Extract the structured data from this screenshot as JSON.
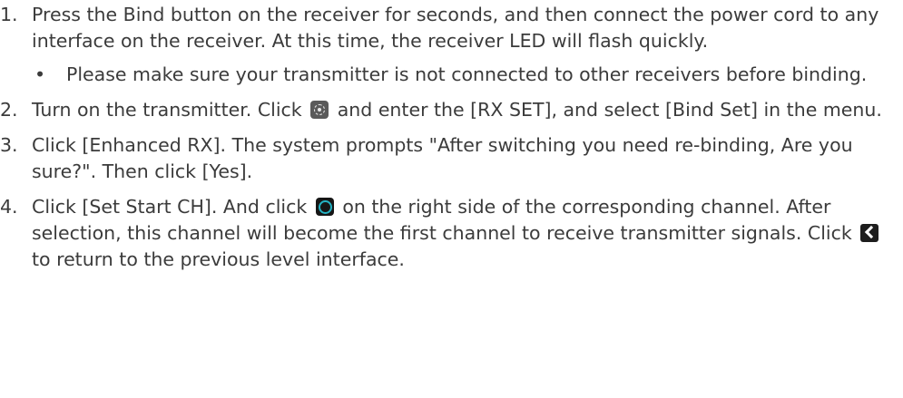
{
  "steps": [
    {
      "num": "1.",
      "text": "Press the Bind button on the receiver for seconds, and then connect the power cord to any interface on the receiver. At this time, the receiver LED will flash quickly."
    },
    {
      "num": "2.",
      "text_before": "Turn on the transmitter. Click",
      "icon": "gear-icon",
      "text_after": "and enter the [RX SET], and select [Bind Set] in the menu."
    },
    {
      "num": "3.",
      "text": "Click [Enhanced RX]. The system prompts \"After switching you need re-binding, Are you sure?\". Then click [Yes]."
    },
    {
      "num": "4.",
      "text_before": "Click [Set Start CH]. And click",
      "icon": "radio-icon",
      "text_middle": "on the right side of the corresponding channel. After selection, this channel will become the first channel to receive transmitter signals. Click",
      "icon2": "back-icon",
      "text_after": "to return to the previous level interface."
    }
  ],
  "bullet": {
    "symbol": "•",
    "text": "Please make sure your transmitter is not connected to other receivers before binding."
  }
}
